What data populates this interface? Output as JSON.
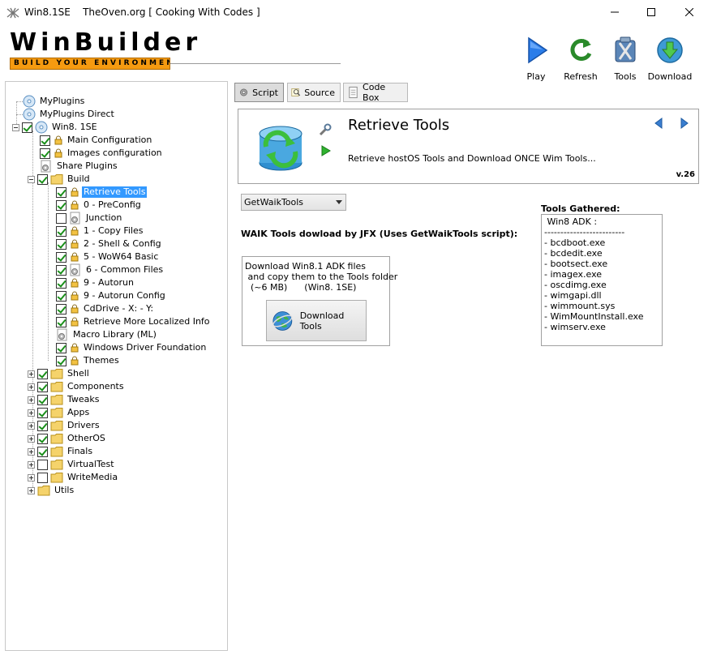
{
  "window": {
    "app_name": "Win8.1SE",
    "subtitle": "TheOven.org [ Cooking With Codes ]"
  },
  "logo": {
    "title": "WinBuilder",
    "tagline": "BUILD YOUR ENVIRONMENT"
  },
  "toolbar": {
    "play": "Play",
    "refresh": "Refresh",
    "tools": "Tools",
    "download": "Download"
  },
  "tree": [
    {
      "label": "MyPlugins"
    },
    {
      "label": "MyPlugins Direct"
    },
    {
      "label": "Win8. 1SE"
    },
    {
      "label": "Main Configuration"
    },
    {
      "label": "Images configuration"
    },
    {
      "label": "Share Plugins"
    },
    {
      "label": "Build"
    },
    {
      "label": "Retrieve Tools"
    },
    {
      "label": "0 - PreConfig"
    },
    {
      "label": "Junction"
    },
    {
      "label": "1 - Copy Files"
    },
    {
      "label": "2 - Shell & Config"
    },
    {
      "label": "5 - WoW64 Basic"
    },
    {
      "label": "6 - Common Files"
    },
    {
      "label": "9 - Autorun"
    },
    {
      "label": "9 - Autorun Config"
    },
    {
      "label": "CdDrive - X: - Y:"
    },
    {
      "label": "Retrieve More Localized Info"
    },
    {
      "label": "Macro Library (ML)"
    },
    {
      "label": "Windows Driver Foundation"
    },
    {
      "label": "Themes"
    },
    {
      "label": "Shell"
    },
    {
      "label": "Components"
    },
    {
      "label": "Tweaks"
    },
    {
      "label": "Apps"
    },
    {
      "label": "Drivers"
    },
    {
      "label": "OtherOS"
    },
    {
      "label": "Finals"
    },
    {
      "label": "VirtualTest"
    },
    {
      "label": "WriteMedia"
    },
    {
      "label": "Utils"
    }
  ],
  "tabs": {
    "script": "Script",
    "source": "Source",
    "codebox": "Code Box"
  },
  "script": {
    "title": "Retrieve Tools",
    "description": "Retrieve hostOS Tools and Download ONCE Wim Tools...",
    "version": "v.26"
  },
  "content": {
    "combo_value": "GetWaikTools",
    "heading": "WAIK Tools dowload by JFX (Uses GetWaikTools script):",
    "box_lines": [
      "Download Win8.1 ADK files",
      " and copy them to the Tools folder",
      "  (~6 MB)      (Win8. 1SE)"
    ],
    "download_button": "Download Tools",
    "gathered_label": "Tools Gathered:",
    "gathered_lines": [
      " Win8 ADK :",
      "-------------------------",
      "- bcdboot.exe",
      "- bcdedit.exe",
      "- bootsect.exe",
      "- imagex.exe",
      "- oscdimg.exe",
      "- wimgapi.dll",
      "- wimmount.sys",
      "- WimMountInstall.exe",
      "- wimserv.exe"
    ]
  }
}
